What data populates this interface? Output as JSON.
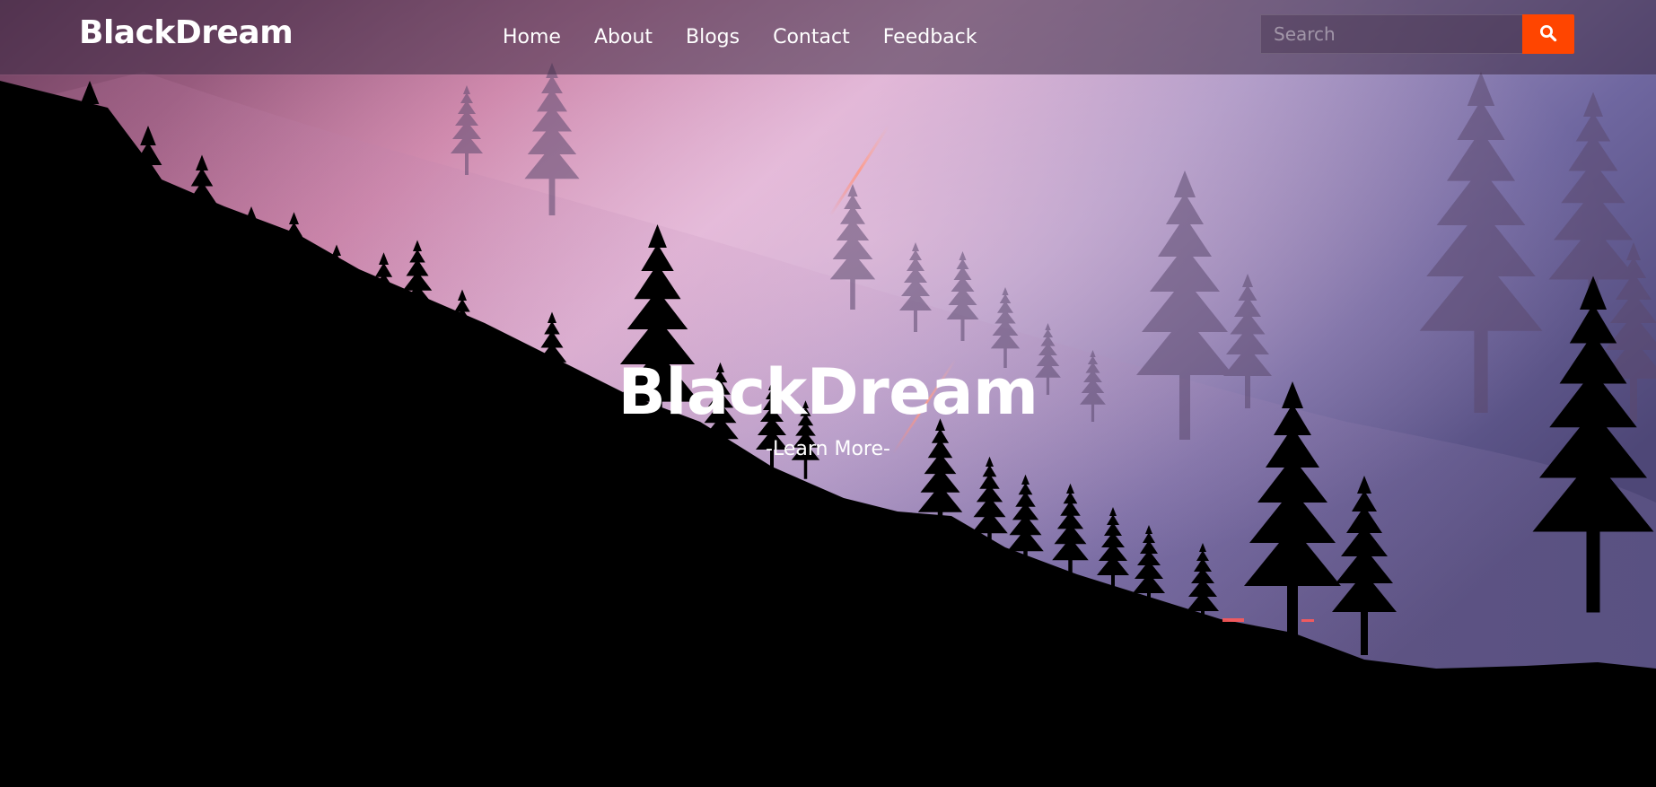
{
  "header": {
    "brand": "BlackDream",
    "nav": [
      {
        "label": "Home"
      },
      {
        "label": "About"
      },
      {
        "label": "Blogs"
      },
      {
        "label": "Contact"
      },
      {
        "label": "Feedback"
      }
    ],
    "search": {
      "placeholder": "Search",
      "value": "",
      "button_icon": "search-icon"
    }
  },
  "hero": {
    "title": "BlackDream",
    "link_label": "-Learn More-",
    "background": "forest-silhouette-at-dusk"
  },
  "colors": {
    "accent": "#ff4500",
    "text": "#ffffff",
    "sky_pink": "#d99bc2",
    "sky_violet": "#7d6fa6",
    "ground": "#000000"
  }
}
